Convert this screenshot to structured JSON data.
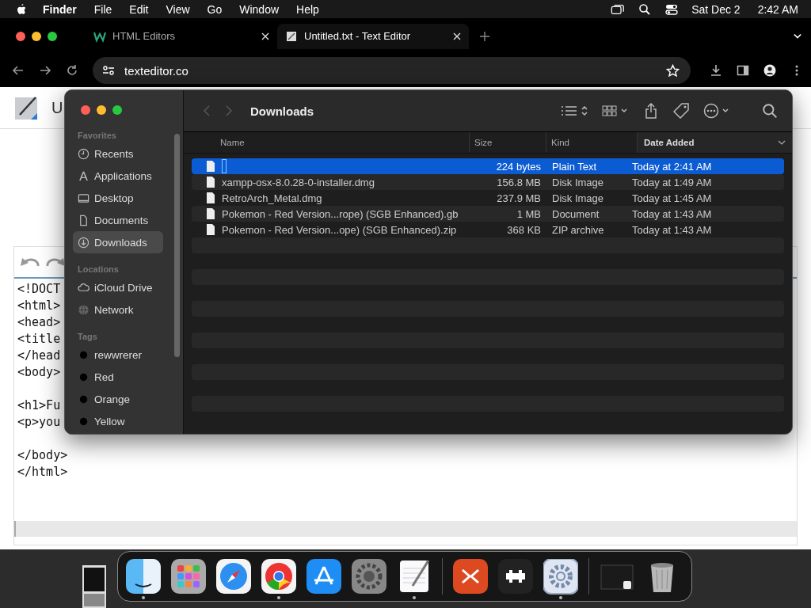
{
  "menu_bar": {
    "app": "Finder",
    "items": [
      "File",
      "Edit",
      "View",
      "Go",
      "Window",
      "Help"
    ],
    "date": "Sat Dec 2",
    "time": "2:42 AM"
  },
  "browser": {
    "tabs": [
      {
        "title": "HTML Editors",
        "selected": false,
        "kind": "site"
      },
      {
        "title": "Untitled.txt - Text Editor",
        "selected": true,
        "kind": "doc"
      }
    ],
    "address": "texteditor.co"
  },
  "editor": {
    "title_fragment": "U",
    "code_blocks": [
      [
        "<!DOCT",
        "<html>",
        "<head>",
        "<title",
        "</head",
        "<body>"
      ],
      [
        "<h1>Fu",
        "<p>you"
      ],
      [
        "</body>",
        "</html>"
      ]
    ]
  },
  "finder": {
    "title": "Downloads",
    "sidebar": [
      {
        "heading": "Favorites",
        "items": [
          {
            "label": "Recents",
            "kind": "clock",
            "selected": false
          },
          {
            "label": "Applications",
            "kind": "apps",
            "selected": false
          },
          {
            "label": "Desktop",
            "kind": "desktop",
            "selected": false
          },
          {
            "label": "Documents",
            "kind": "doc",
            "selected": false
          },
          {
            "label": "Downloads",
            "kind": "download",
            "selected": true
          }
        ]
      },
      {
        "heading": "Locations",
        "items": [
          {
            "label": "iCloud Drive",
            "kind": "cloud",
            "selected": false
          },
          {
            "label": "Network",
            "kind": "globe",
            "selected": false
          }
        ]
      },
      {
        "heading": "Tags",
        "items": [
          {
            "label": "rewwrerer",
            "kind": "tag",
            "selected": false
          },
          {
            "label": "Red",
            "kind": "tag",
            "selected": false
          },
          {
            "label": "Orange",
            "kind": "tag",
            "selected": false
          },
          {
            "label": "Yellow",
            "kind": "tag",
            "selected": false
          }
        ]
      }
    ],
    "columns": [
      {
        "label": "Name",
        "sorted": false
      },
      {
        "label": "Size",
        "sorted": false
      },
      {
        "label": "Kind",
        "sorted": false
      },
      {
        "label": "Date Added",
        "sorted": true
      }
    ],
    "files": [
      {
        "renaming": true,
        "size": "224 bytes",
        "kind": "Plain Text",
        "date": "Today at 2:41 AM",
        "selected": true
      },
      {
        "name": "xampp-osx-8.0.28-0-installer.dmg",
        "size": "156.8 MB",
        "kind": "Disk Image",
        "date": "Today at 1:49 AM",
        "selected": false
      },
      {
        "name": "RetroArch_Metal.dmg",
        "size": "237.9 MB",
        "kind": "Disk Image",
        "date": "Today at 1:45 AM",
        "selected": false
      },
      {
        "name": "Pokemon - Red Version...rope) (SGB Enhanced).gb",
        "size": "1 MB",
        "kind": "Document",
        "date": "Today at 1:43 AM",
        "selected": false
      },
      {
        "name": "Pokemon - Red Version...ope) (SGB Enhanced).zip",
        "size": "368 KB",
        "kind": "ZIP archive",
        "date": "Today at 1:43 AM",
        "selected": false
      }
    ]
  },
  "dock": [
    {
      "kind": "finder",
      "running": true
    },
    {
      "kind": "launchpad",
      "running": false
    },
    {
      "kind": "safari",
      "running": false
    },
    {
      "kind": "chrome",
      "running": true
    },
    {
      "kind": "appstore",
      "running": false
    },
    {
      "kind": "settings",
      "running": false
    },
    {
      "kind": "textedit",
      "running": true
    },
    {
      "kind": "divider"
    },
    {
      "kind": "remote",
      "running": false
    },
    {
      "kind": "retro",
      "running": false
    },
    {
      "kind": "gearapp",
      "running": true
    },
    {
      "kind": "divider"
    },
    {
      "kind": "window",
      "running": false
    },
    {
      "kind": "trash",
      "running": false
    }
  ]
}
